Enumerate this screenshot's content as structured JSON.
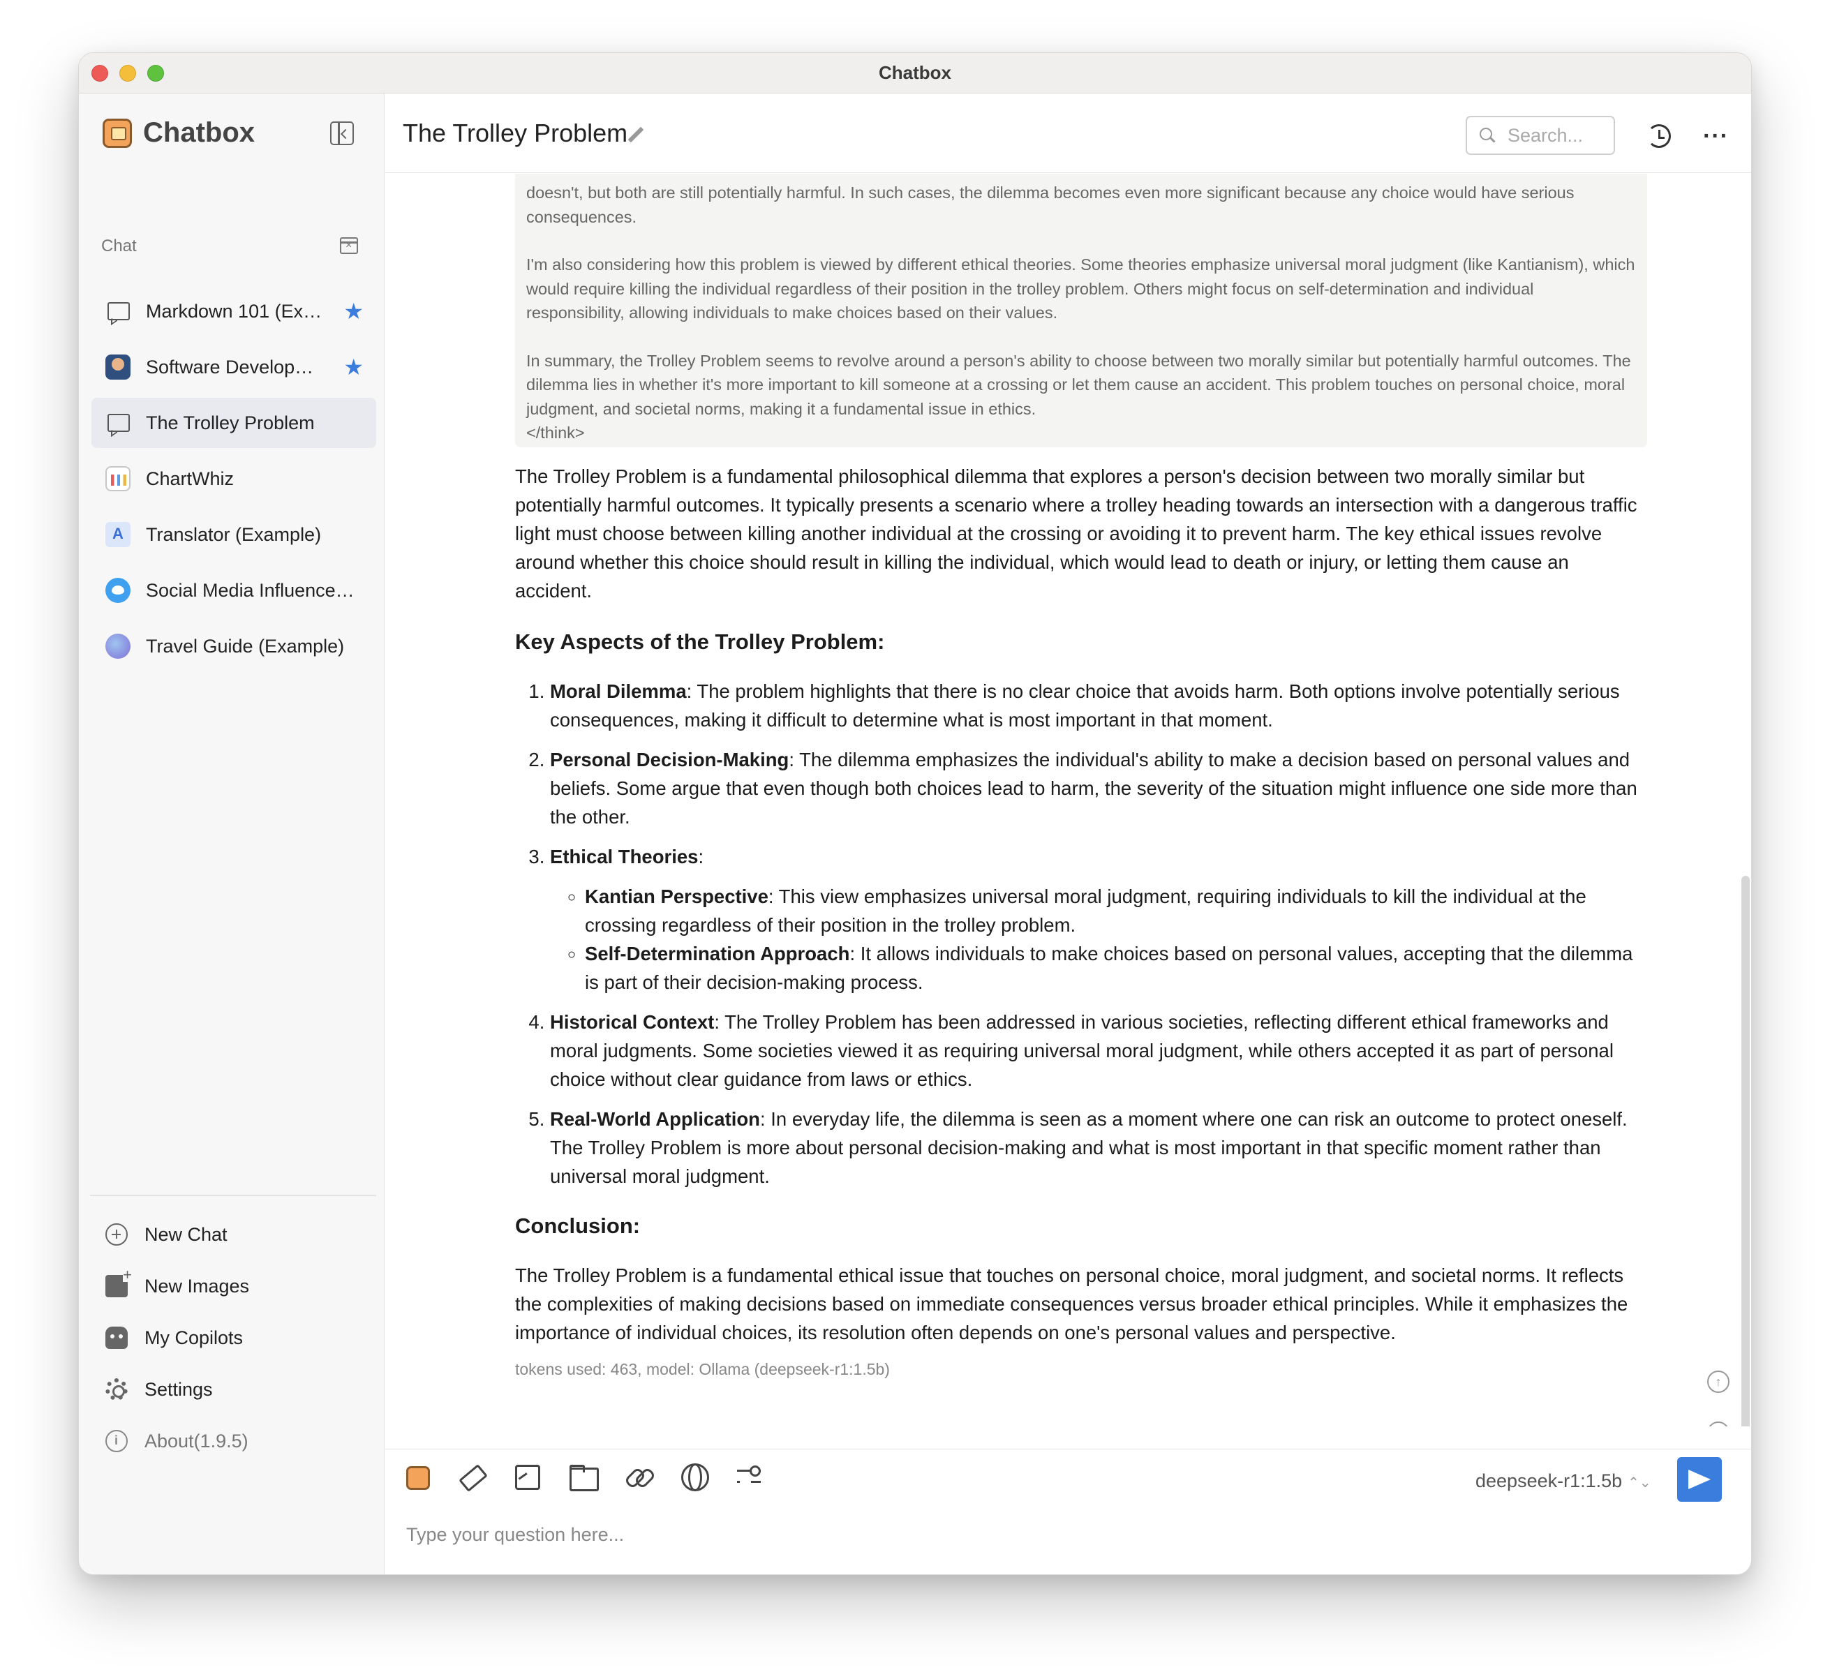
{
  "window": {
    "title": "Chatbox"
  },
  "sidebar": {
    "brand": "Chatbox",
    "section_label": "Chat",
    "chats": [
      {
        "label": "Markdown 101 (Ex…",
        "icon": "chat-bubble-icon",
        "starred": true,
        "active": false
      },
      {
        "label": "Software Develop…",
        "icon": "developer-avatar",
        "starred": true,
        "active": false
      },
      {
        "label": "The Trolley Problem",
        "icon": "chat-bubble-icon",
        "starred": false,
        "active": true
      },
      {
        "label": "ChartWhiz",
        "icon": "chartwhiz-avatar",
        "starred": false,
        "active": false
      },
      {
        "label": "Translator (Example)",
        "icon": "translator-avatar",
        "starred": false,
        "active": false
      },
      {
        "label": "Social Media Influencer …",
        "icon": "twitter-bird-avatar",
        "starred": false,
        "active": false
      },
      {
        "label": "Travel Guide (Example)",
        "icon": "globe-avatar",
        "starred": false,
        "active": false
      }
    ],
    "bottom_menu": [
      {
        "label": "New Chat",
        "icon": "plus-circle-icon"
      },
      {
        "label": "New Images",
        "icon": "image-plus-icon"
      },
      {
        "label": "My Copilots",
        "icon": "robot-icon"
      },
      {
        "label": "Settings",
        "icon": "gear-icon"
      },
      {
        "label": "About(1.9.5)",
        "icon": "info-icon"
      }
    ]
  },
  "header": {
    "title": "The Trolley Problem",
    "search_placeholder": "Search..."
  },
  "message": {
    "think_paragraphs": [
      "doesn't, but both are still potentially harmful. In such cases, the dilemma becomes even more significant because any choice would have serious consequences.",
      "I'm also considering how this problem is viewed by different ethical theories. Some theories emphasize universal moral judgment (like Kantianism), which would require killing the individual regardless of their position in the trolley problem. Others might focus on self-determination and individual responsibility, allowing individuals to make choices based on their values.",
      "In summary, the Trolley Problem seems to revolve around a person's ability to choose between two morally similar but potentially harmful outcomes. The dilemma lies in whether it's more important to kill someone at a crossing or let them cause an accident. This problem touches on personal choice, moral judgment, and societal norms, making it a fundamental issue in ethics."
    ],
    "think_close": "</think>",
    "intro": "The Trolley Problem is a fundamental philosophical dilemma that explores a person's decision between two morally similar but potentially harmful outcomes. It typically presents a scenario where a trolley heading towards an intersection with a dangerous traffic light must choose between killing another individual at the crossing or avoiding it to prevent harm. The key ethical issues revolve around whether this choice should result in killing the individual, which would lead to death or injury, or letting them cause an accident.",
    "heading_aspects": "Key Aspects of the Trolley Problem:",
    "aspects": [
      {
        "term": "Moral Dilemma",
        "text": ": The problem highlights that there is no clear choice that avoids harm. Both options involve potentially serious consequences, making it difficult to determine what is most important in that moment."
      },
      {
        "term": "Personal Decision-Making",
        "text": ": The dilemma emphasizes the individual's ability to make a decision based on personal values and beliefs. Some argue that even though both choices lead to harm, the severity of the situation might influence one side more than the other."
      },
      {
        "term": "Ethical Theories",
        "text": ":"
      },
      {
        "term": "Historical Context",
        "text": ": The Trolley Problem has been addressed in various societies, reflecting different ethical frameworks and moral judgments. Some societies viewed it as requiring universal moral judgment, while others accepted it as part of personal choice without clear guidance from laws or ethics."
      },
      {
        "term": "Real-World Application",
        "text": ": In everyday life, the dilemma is seen as a moment where one can risk an outcome to protect oneself. The Trolley Problem is more about personal decision-making and what is most important in that specific moment rather than universal moral judgment."
      }
    ],
    "ethical_sub": [
      {
        "term": "Kantian Perspective",
        "text": ": This view emphasizes universal moral judgment, requiring individuals to kill the individual at the crossing regardless of their position in the trolley problem."
      },
      {
        "term": "Self-Determination Approach",
        "text": ": It allows individuals to make choices based on personal values, accepting that the dilemma is part of their decision-making process."
      }
    ],
    "heading_conclusion": "Conclusion:",
    "conclusion": "The Trolley Problem is a fundamental ethical issue that touches on personal choice, moral judgment, and societal norms. It reflects the complexities of making decisions based on immediate consequences versus broader ethical principles. While it emphasizes the importance of individual choices, its resolution often depends on one's personal values and perspective.",
    "token_info": "tokens used: 463, model: Ollama (deepseek-r1:1.5b)"
  },
  "composer": {
    "model": "deepseek-r1:1.5b",
    "model_arrows": "⌃⌄",
    "placeholder": "Type your question here..."
  },
  "colors": {
    "accent": "#3b7ddd",
    "sidebar_bg": "#f7f7f7",
    "active_item_bg": "#e8eaef",
    "think_bg": "#f4f4f3"
  }
}
